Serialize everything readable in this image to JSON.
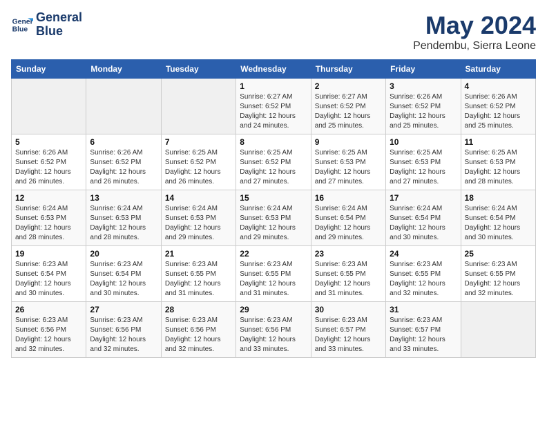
{
  "logo": {
    "line1": "General",
    "line2": "Blue"
  },
  "title": {
    "month_year": "May 2024",
    "location": "Pendembu, Sierra Leone"
  },
  "weekdays": [
    "Sunday",
    "Monday",
    "Tuesday",
    "Wednesday",
    "Thursday",
    "Friday",
    "Saturday"
  ],
  "weeks": [
    [
      {
        "day": "",
        "info": ""
      },
      {
        "day": "",
        "info": ""
      },
      {
        "day": "",
        "info": ""
      },
      {
        "day": "1",
        "info": "Sunrise: 6:27 AM\nSunset: 6:52 PM\nDaylight: 12 hours and 24 minutes."
      },
      {
        "day": "2",
        "info": "Sunrise: 6:27 AM\nSunset: 6:52 PM\nDaylight: 12 hours and 25 minutes."
      },
      {
        "day": "3",
        "info": "Sunrise: 6:26 AM\nSunset: 6:52 PM\nDaylight: 12 hours and 25 minutes."
      },
      {
        "day": "4",
        "info": "Sunrise: 6:26 AM\nSunset: 6:52 PM\nDaylight: 12 hours and 25 minutes."
      }
    ],
    [
      {
        "day": "5",
        "info": "Sunrise: 6:26 AM\nSunset: 6:52 PM\nDaylight: 12 hours and 26 minutes."
      },
      {
        "day": "6",
        "info": "Sunrise: 6:26 AM\nSunset: 6:52 PM\nDaylight: 12 hours and 26 minutes."
      },
      {
        "day": "7",
        "info": "Sunrise: 6:25 AM\nSunset: 6:52 PM\nDaylight: 12 hours and 26 minutes."
      },
      {
        "day": "8",
        "info": "Sunrise: 6:25 AM\nSunset: 6:52 PM\nDaylight: 12 hours and 27 minutes."
      },
      {
        "day": "9",
        "info": "Sunrise: 6:25 AM\nSunset: 6:53 PM\nDaylight: 12 hours and 27 minutes."
      },
      {
        "day": "10",
        "info": "Sunrise: 6:25 AM\nSunset: 6:53 PM\nDaylight: 12 hours and 27 minutes."
      },
      {
        "day": "11",
        "info": "Sunrise: 6:25 AM\nSunset: 6:53 PM\nDaylight: 12 hours and 28 minutes."
      }
    ],
    [
      {
        "day": "12",
        "info": "Sunrise: 6:24 AM\nSunset: 6:53 PM\nDaylight: 12 hours and 28 minutes."
      },
      {
        "day": "13",
        "info": "Sunrise: 6:24 AM\nSunset: 6:53 PM\nDaylight: 12 hours and 28 minutes."
      },
      {
        "day": "14",
        "info": "Sunrise: 6:24 AM\nSunset: 6:53 PM\nDaylight: 12 hours and 29 minutes."
      },
      {
        "day": "15",
        "info": "Sunrise: 6:24 AM\nSunset: 6:53 PM\nDaylight: 12 hours and 29 minutes."
      },
      {
        "day": "16",
        "info": "Sunrise: 6:24 AM\nSunset: 6:54 PM\nDaylight: 12 hours and 29 minutes."
      },
      {
        "day": "17",
        "info": "Sunrise: 6:24 AM\nSunset: 6:54 PM\nDaylight: 12 hours and 30 minutes."
      },
      {
        "day": "18",
        "info": "Sunrise: 6:24 AM\nSunset: 6:54 PM\nDaylight: 12 hours and 30 minutes."
      }
    ],
    [
      {
        "day": "19",
        "info": "Sunrise: 6:23 AM\nSunset: 6:54 PM\nDaylight: 12 hours and 30 minutes."
      },
      {
        "day": "20",
        "info": "Sunrise: 6:23 AM\nSunset: 6:54 PM\nDaylight: 12 hours and 30 minutes."
      },
      {
        "day": "21",
        "info": "Sunrise: 6:23 AM\nSunset: 6:55 PM\nDaylight: 12 hours and 31 minutes."
      },
      {
        "day": "22",
        "info": "Sunrise: 6:23 AM\nSunset: 6:55 PM\nDaylight: 12 hours and 31 minutes."
      },
      {
        "day": "23",
        "info": "Sunrise: 6:23 AM\nSunset: 6:55 PM\nDaylight: 12 hours and 31 minutes."
      },
      {
        "day": "24",
        "info": "Sunrise: 6:23 AM\nSunset: 6:55 PM\nDaylight: 12 hours and 32 minutes."
      },
      {
        "day": "25",
        "info": "Sunrise: 6:23 AM\nSunset: 6:55 PM\nDaylight: 12 hours and 32 minutes."
      }
    ],
    [
      {
        "day": "26",
        "info": "Sunrise: 6:23 AM\nSunset: 6:56 PM\nDaylight: 12 hours and 32 minutes."
      },
      {
        "day": "27",
        "info": "Sunrise: 6:23 AM\nSunset: 6:56 PM\nDaylight: 12 hours and 32 minutes."
      },
      {
        "day": "28",
        "info": "Sunrise: 6:23 AM\nSunset: 6:56 PM\nDaylight: 12 hours and 32 minutes."
      },
      {
        "day": "29",
        "info": "Sunrise: 6:23 AM\nSunset: 6:56 PM\nDaylight: 12 hours and 33 minutes."
      },
      {
        "day": "30",
        "info": "Sunrise: 6:23 AM\nSunset: 6:57 PM\nDaylight: 12 hours and 33 minutes."
      },
      {
        "day": "31",
        "info": "Sunrise: 6:23 AM\nSunset: 6:57 PM\nDaylight: 12 hours and 33 minutes."
      },
      {
        "day": "",
        "info": ""
      }
    ]
  ]
}
